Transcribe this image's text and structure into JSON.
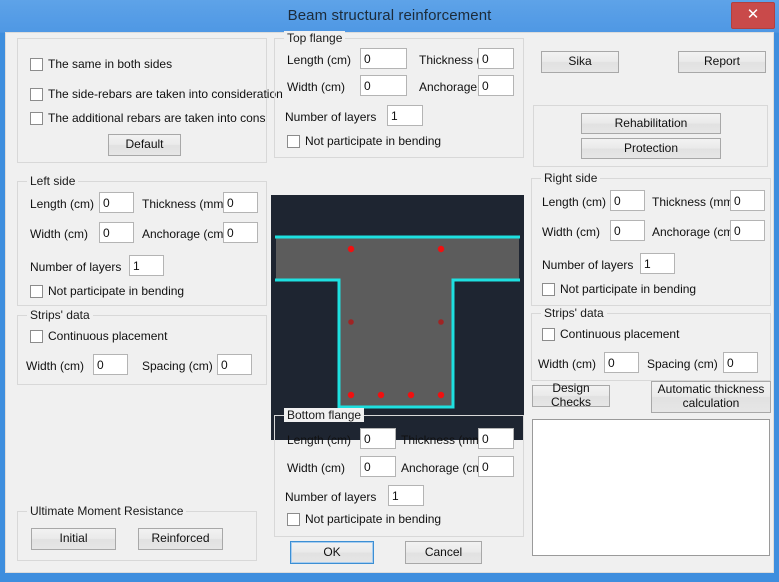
{
  "window": {
    "title": "Beam structural reinforcement",
    "close_label": "✕"
  },
  "options_panel": {
    "checkboxes": [
      {
        "label": "The same in both sides",
        "checked": false
      },
      {
        "label": "The side-rebars are taken into consideration",
        "checked": false
      },
      {
        "label": "The additional rebars are taken into consider",
        "checked": false
      }
    ],
    "default_button": "Default"
  },
  "top_flange": {
    "title": "Top flange",
    "length_label": "Length (cm)",
    "length_value": "0",
    "thickness_label": "Thickness (mm)",
    "thickness_value": "0",
    "width_label": "Width (cm)",
    "width_value": "0",
    "anchorage_label": "Anchorage (cm)",
    "anchorage_value": "0",
    "layers_label": "Number of layers",
    "layers_value": "1",
    "not_bending_label": "Not participate in bending",
    "not_bending_checked": false
  },
  "bottom_flange": {
    "title": "Bottom flange",
    "length_label": "Length (cm)",
    "length_value": "0",
    "thickness_label": "Thickness (mm)",
    "thickness_value": "0",
    "width_label": "Width (cm)",
    "width_value": "0",
    "anchorage_label": "Anchorage (cm)",
    "anchorage_value": "0",
    "layers_label": "Number of layers",
    "layers_value": "1",
    "not_bending_label": "Not participate in bending",
    "not_bending_checked": false
  },
  "left_side": {
    "title": "Left side",
    "length_label": "Length (cm)",
    "length_value": "0",
    "thickness_label": "Thickness (mm)",
    "thickness_value": "0",
    "width_label": "Width (cm)",
    "width_value": "0",
    "anchorage_label": "Anchorage (cm)",
    "anchorage_value": "0",
    "layers_label": "Number of layers",
    "layers_value": "1",
    "not_bending_label": "Not participate in bending",
    "not_bending_checked": false
  },
  "right_side": {
    "title": "Right side",
    "length_label": "Length (cm)",
    "length_value": "0",
    "thickness_label": "Thickness (mm)",
    "thickness_value": "0",
    "width_label": "Width (cm)",
    "width_value": "0",
    "anchorage_label": "Anchorage (cm)",
    "anchorage_value": "0",
    "layers_label": "Number of layers",
    "layers_value": "1",
    "not_bending_label": "Not participate in bending",
    "not_bending_checked": false
  },
  "left_strips": {
    "title": "Strips' data",
    "continuous_label": "Continuous placement",
    "continuous_checked": false,
    "width_label": "Width (cm)",
    "width_value": "0",
    "spacing_label": "Spacing (cm)",
    "spacing_value": "0"
  },
  "right_strips": {
    "title": "Strips' data",
    "continuous_label": "Continuous placement",
    "continuous_checked": false,
    "width_label": "Width (cm)",
    "width_value": "0",
    "spacing_label": "Spacing (cm)",
    "spacing_value": "0"
  },
  "toolbar": {
    "sika_label": "Sika",
    "report_label": "Report",
    "rehabilitation_label": "Rehabilitation",
    "protection_label": "Protection"
  },
  "right_actions": {
    "design_checks_label": "Design Checks",
    "auto_thickness_label": "Automatic thickness calculation"
  },
  "moment": {
    "title": "Ultimate Moment Resistance",
    "initial_label": "Initial",
    "reinforced_label": "Reinforced"
  },
  "dialog_buttons": {
    "ok_label": "OK",
    "cancel_label": "Cancel"
  },
  "results_box": {
    "content": ""
  },
  "drawing": {
    "background_color": "#1e2531",
    "section_fill": "#5c5c5c",
    "outline_color": "#1ee0e0",
    "rebar_color": "#f01010",
    "rebar_side_color": "#b02020",
    "shape": "T-beam cross section",
    "top_rebars": 2,
    "side_rebars": 2,
    "bottom_rebars": 4
  }
}
